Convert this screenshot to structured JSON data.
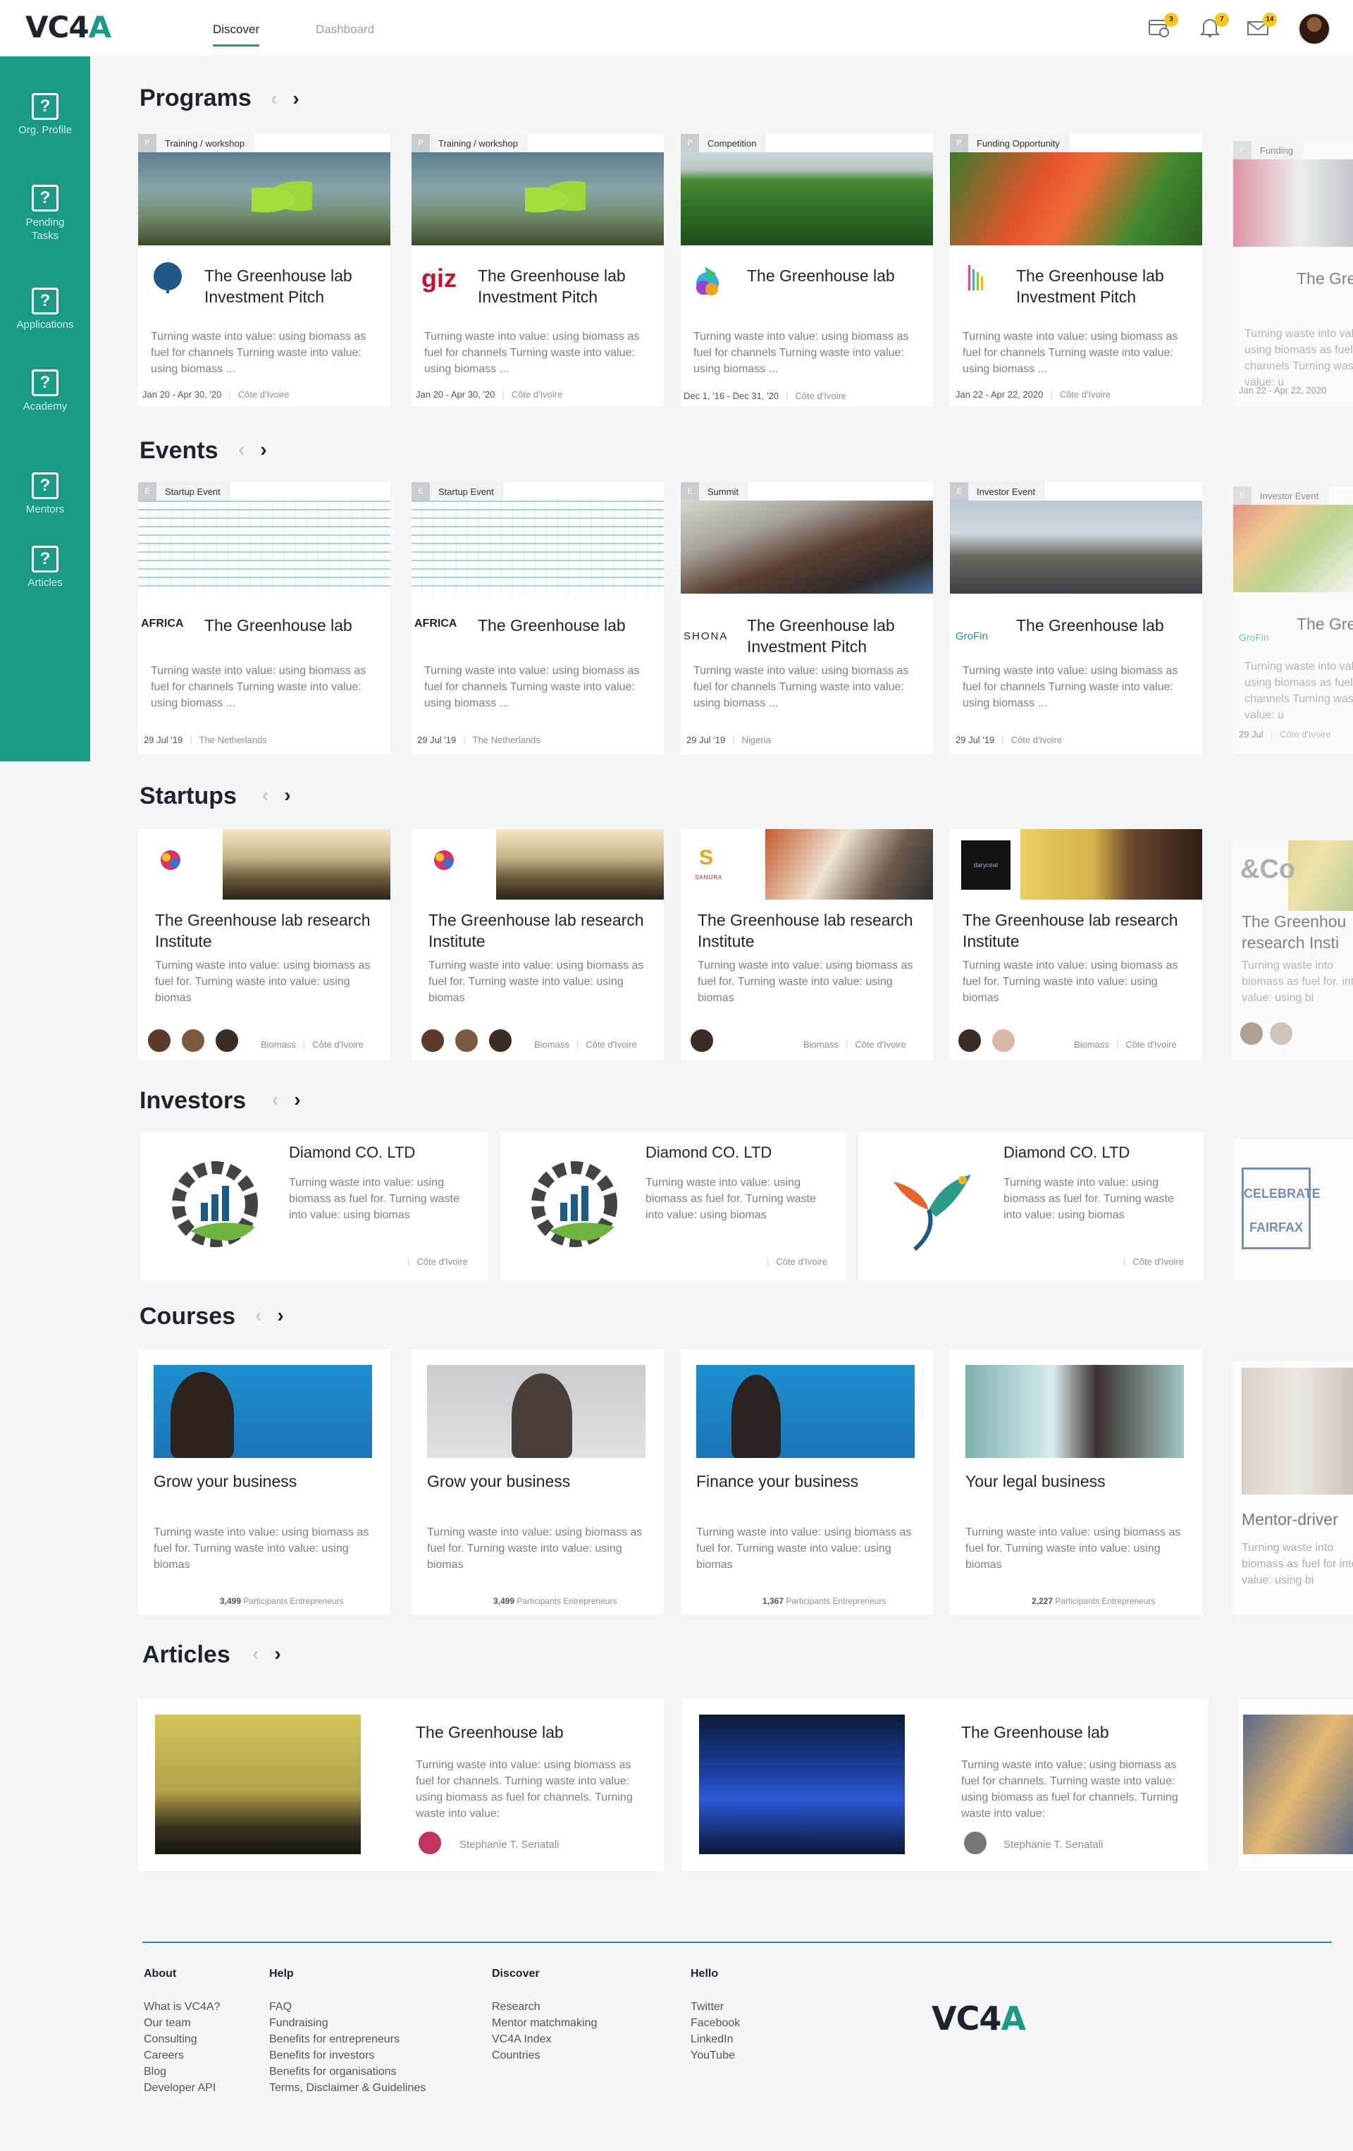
{
  "header": {
    "logo_main": "VC4",
    "logo_accent": "A",
    "tabs": [
      {
        "label": "Discover"
      },
      {
        "label": "Dashboard"
      }
    ],
    "badges": {
      "calendar": "3",
      "bell": "7",
      "mail": "14"
    }
  },
  "sidebar": {
    "items": [
      {
        "label": "Org. Profile"
      },
      {
        "label": "Pending Tasks"
      },
      {
        "label": "Applications"
      },
      {
        "label": "Academy"
      },
      {
        "label": "Mentors"
      },
      {
        "label": "Articles"
      }
    ]
  },
  "programs": {
    "title": "Programs",
    "cards": [
      {
        "tag_key": "P",
        "tag": "Training / workshop",
        "title": "The Greenhouse lab Investment Pitch",
        "desc": "Turning waste into value: using biomass as fuel for channels Turning waste into value: using biomass ...",
        "date": "Jan 20 - Apr 30, '20",
        "location": "Côte d'Ivoire",
        "logo": "AKADUSA"
      },
      {
        "tag_key": "P",
        "tag": "Training / workshop",
        "title": "The Greenhouse lab Investment Pitch",
        "desc": "Turning waste into value: using biomass as fuel for channels Turning waste into value: using biomass ...",
        "date": "Jan 20 - Apr 30, '20",
        "location": "Côte d'Ivoire",
        "logo": "giz"
      },
      {
        "tag_key": "P",
        "tag": "Competition",
        "title": "The Greenhouse lab",
        "desc": "Turning waste into value: using biomass as fuel for channels Turning waste into value: using biomass ...",
        "date": "Dec 1, '16 - Dec 31, '20",
        "location": "Côte d'Ivoire"
      },
      {
        "tag_key": "P",
        "tag": "Funding Opportunity",
        "title": "The Greenhouse lab Investment Pitch",
        "desc": "Turning waste into value: using biomass as fuel for channels Turning waste into value: using biomass ...",
        "date": "Jan 22 - Apr 22, 2020",
        "location": "Côte d'Ivoire"
      },
      {
        "tag_key": "P",
        "tag": "Funding",
        "title": "The Gre",
        "desc": "Turning waste into value: using biomass as fuel for channels Turning waste into value: u",
        "date": "Jan 22 - Apr 22, 2020",
        "location": ""
      }
    ]
  },
  "events": {
    "title": "Events",
    "cards": [
      {
        "tag_key": "E",
        "tag": "Startup Event",
        "title": "The Greenhouse lab",
        "desc": "Turning waste into value: using biomass as fuel for channels Turning waste into value: using biomass ...",
        "date": "29 Jul '19",
        "location": "The Netherlands",
        "logo": "AFRICA"
      },
      {
        "tag_key": "E",
        "tag": "Startup Event",
        "title": "The Greenhouse lab",
        "desc": "Turning waste into value: using biomass as fuel for channels Turning waste into value: using biomass ...",
        "date": "29 Jul '19",
        "location": "The Netherlands",
        "logo": "AFRICA"
      },
      {
        "tag_key": "E",
        "tag": "Summit",
        "title": "The Greenhouse lab Investment Pitch",
        "desc": "Turning waste into value: using biomass as fuel for channels Turning waste into value: using biomass ...",
        "date": "29 Jul '19",
        "location": "Nigeria",
        "logo": "SHONA"
      },
      {
        "tag_key": "E",
        "tag": "Investor Event",
        "title": "The Greenhouse lab",
        "desc": "Turning waste into value: using biomass as fuel for channels Turning waste into value: using biomass ...",
        "date": "29 Jul '19",
        "location": "Côte d'Ivoire",
        "logo": "GroFin"
      },
      {
        "tag_key": "E",
        "tag": "Investor Event",
        "title": "The Gre",
        "desc": "Turning waste into value: using biomass as fuel for channels Turning waste into value: u",
        "date": "29 Jul",
        "location": "Côte d'Ivoire",
        "logo": "GroFin"
      }
    ]
  },
  "startups": {
    "title": "Startups",
    "cards": [
      {
        "title": "The Greenhouse lab research Institute",
        "desc": "Turning waste into value: using biomass as fuel for. Turning waste into value: using biomas",
        "sector": "Biomass",
        "location": "Côte d'Ivoire",
        "logo": "livestroo"
      },
      {
        "title": "The Greenhouse lab research Institute",
        "desc": "Turning waste into value: using biomass as fuel for. Turning waste into value: using biomas",
        "sector": "Biomass",
        "location": "Côte d'Ivoire",
        "logo": "livestroo"
      },
      {
        "title": "The Greenhouse lab research Institute",
        "desc": "Turning waste into value: using biomass as fuel for. Turning waste into value: using biomas",
        "sector": "Biomass",
        "location": "Côte d'Ivoire",
        "logo": "SANURA"
      },
      {
        "title": "The Greenhouse lab research Institute",
        "desc": "Turning waste into value: using biomass as fuel for. Turning waste into value: using biomas",
        "sector": "Biomass",
        "location": "Côte d'Ivoire",
        "logo": "daryceat"
      },
      {
        "title": "The Greenhou research Insti",
        "desc": "Turning waste into biomass as fuel for. into value: using bi",
        "sector": "",
        "location": "",
        "logo": "&Co"
      }
    ]
  },
  "investors": {
    "title": "Investors",
    "cards": [
      {
        "name": "Diamond CO. LTD",
        "desc": "Turning waste into value: using biomass as fuel for. Turning waste into value: using biomas",
        "location": "Côte d'Ivoire"
      },
      {
        "name": "Diamond CO. LTD",
        "desc": "Turning waste into value: using biomass as fuel for. Turning waste into value: using biomas",
        "location": "Côte d'Ivoire"
      },
      {
        "name": "Diamond CO. LTD",
        "desc": "Turning waste into value: using biomass as fuel for. Turning waste into value: using biomas",
        "location": "Côte d'Ivoire"
      },
      {
        "name": "CELEBRATE FAIRFAX",
        "desc": "",
        "location": ""
      }
    ]
  },
  "courses": {
    "title": "Courses",
    "participants_label": "Participants Entrepreneurs",
    "cards": [
      {
        "title": "Grow your business",
        "desc": "Turning waste into value: using biomass as fuel for. Turning waste into value: using biomas",
        "count": "3,499"
      },
      {
        "title": "Grow your business",
        "desc": "Turning waste into value: using biomass as fuel for. Turning waste into value: using biomas",
        "count": "3,499"
      },
      {
        "title": "Finance your business",
        "desc": "Turning waste into value: using biomass as fuel for. Turning waste into value: using biomas",
        "count": "1,367"
      },
      {
        "title": "Your legal business",
        "desc": "Turning waste into value: using biomass as fuel for. Turning waste into value: using biomas",
        "count": "2,227"
      },
      {
        "title": "Mentor-driver",
        "desc": "Turning waste into biomass as fuel for into value: using bi",
        "count": ""
      }
    ]
  },
  "articles": {
    "title": "Articles",
    "cards": [
      {
        "title": "The Greenhouse lab",
        "desc": "Turning waste into value: using biomass as fuel for channels. Turning waste into value: using biomass as fuel for channels. Turning waste into value:",
        "author": "Stephanie T. Senatali"
      },
      {
        "title": "The Greenhouse lab",
        "desc": "Turning waste into value: using biomass as fuel for channels. Turning waste into value: using biomass as fuel for channels. Turning waste into value:",
        "author": "Stephanie T. Senatali"
      }
    ]
  },
  "footer": {
    "columns": [
      {
        "heading": "About",
        "links": [
          "What is VC4A?",
          "Our team",
          "Consulting",
          "Careers",
          "Blog",
          "Developer API"
        ]
      },
      {
        "heading": "Help",
        "links": [
          "FAQ",
          "Fundraising",
          "Benefits for entrepreneurs",
          "Benefits for investors",
          "Benefits for organisations",
          "Terms, Disclaimer & Guidelines"
        ]
      },
      {
        "heading": "Discover",
        "links": [
          "Research",
          "Mentor matchmaking",
          "VC4A Index",
          "Countries"
        ]
      },
      {
        "heading": "Hello",
        "links": [
          "Twitter",
          "Facebook",
          "LinkedIn",
          "YouTube"
        ]
      }
    ],
    "logo_main": "VC4",
    "logo_accent": "A"
  },
  "colors": {
    "brand": "#1a9b85",
    "badge": "#f4c91c",
    "dark": "#1d2430"
  }
}
